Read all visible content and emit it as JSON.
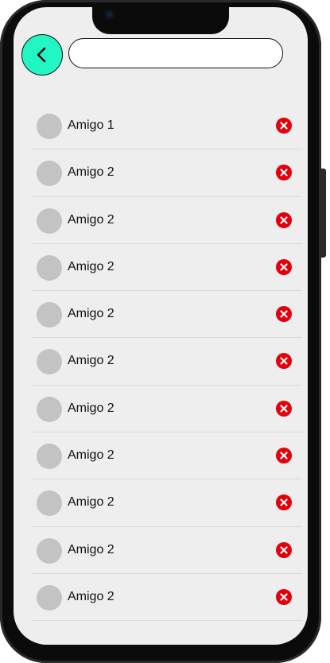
{
  "header": {
    "back_icon": "chevron-left-icon",
    "accent_color": "#22f7c4",
    "search": {
      "value": "",
      "placeholder": ""
    }
  },
  "friends": {
    "remove_icon": "close-circle-icon",
    "remove_color": "#e3000b",
    "items": [
      {
        "name": "Amigo 1"
      },
      {
        "name": "Amigo 2"
      },
      {
        "name": "Amigo 2"
      },
      {
        "name": "Amigo 2"
      },
      {
        "name": "Amigo 2"
      },
      {
        "name": "Amigo 2"
      },
      {
        "name": "Amigo 2"
      },
      {
        "name": "Amigo 2"
      },
      {
        "name": "Amigo 2"
      },
      {
        "name": "Amigo 2"
      },
      {
        "name": "Amigo 2"
      }
    ]
  }
}
